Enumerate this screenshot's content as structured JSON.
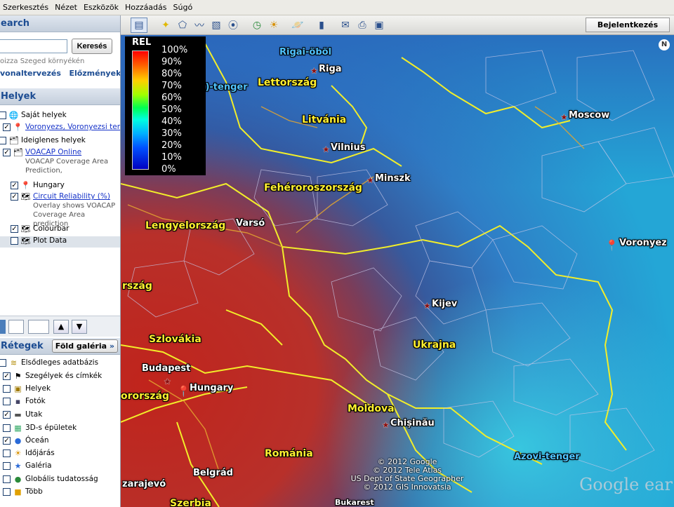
{
  "menu": [
    "Szerkesztés",
    "Nézet",
    "Eszközök",
    "Hozzáadás",
    "Súgó"
  ],
  "search": {
    "title": "earch",
    "input_value": "",
    "button": "Keresés",
    "hint": "oizza Szeged környékén",
    "link_route": "vonaltervezés",
    "link_history": "Előzmények"
  },
  "places": {
    "title": "Helyek",
    "items": [
      {
        "label": "Saját helyek",
        "link": false
      },
      {
        "label": "Voronyezs, Voronyezsi terül",
        "link": true
      },
      {
        "label": "Ideiglenes helyek",
        "link": false
      },
      {
        "label": "VOACAP Online",
        "link": true,
        "sub": "VOACAP Coverage Area Prediction,"
      },
      {
        "label": "Hungary",
        "link": false
      },
      {
        "label": "Circuit Reliability (%)",
        "link": true,
        "sub": "Overlay shows VOACAP Coverage Area prediction"
      },
      {
        "label": "Colourbar",
        "link": false
      },
      {
        "label": "Plot Data",
        "link": false
      }
    ]
  },
  "layers": {
    "title": "Rétegek",
    "gallery_button": "Föld galéria",
    "items": [
      "Elsődleges adatbázis",
      "Szegélyek és címkék",
      "Helyek",
      "Fotók",
      "Utak",
      "3D-s épületek",
      "Óceán",
      "Időjárás",
      "Galéria",
      "Globális tudatosság",
      "Több"
    ]
  },
  "toolbar": {
    "login": "Bejelentkezés"
  },
  "legend": {
    "title": "REL",
    "ticks": [
      "100%",
      "90%",
      "80%",
      "70%",
      "60%",
      "50%",
      "40%",
      "30%",
      "20%",
      "10%",
      "0%"
    ]
  },
  "map_labels": {
    "rigai": "Rigai-öböl",
    "riga": "Riga",
    "tenger": "i)-tenger",
    "lettorszag": "Lettország",
    "litvania": "Litvánia",
    "vilnius": "Vilnius",
    "minszk": "Minszk",
    "feheroroszorszag": "Fehéroroszország",
    "moscow": "Moscow",
    "lengyelorszag": "Lengyelország",
    "varso": "Varsó",
    "voronyezs": "Voronyez",
    "rszag": "rszág",
    "kijev": "Kijev",
    "ukrajna": "Ukrajna",
    "szlovakia": "Szlovákia",
    "budapest": "Budapest",
    "hungary": "Hungary",
    "orszag": "orország",
    "moldova": "Moldova",
    "chisinau": "Chișinău",
    "romania": "Románia",
    "azovi": "Azovi-tenger",
    "belgrad": "Belgrád",
    "szarajevo": "zarajevó",
    "szerbia": "Szerbia",
    "bukarest": "Bukarest",
    "north": "N"
  },
  "attribution": [
    "© 2012 Google",
    "© 2012 Tele Atlas",
    "US Dept of State Geographer",
    "© 2012 GIS Innovatsia"
  ],
  "google_logo": "Google ear"
}
